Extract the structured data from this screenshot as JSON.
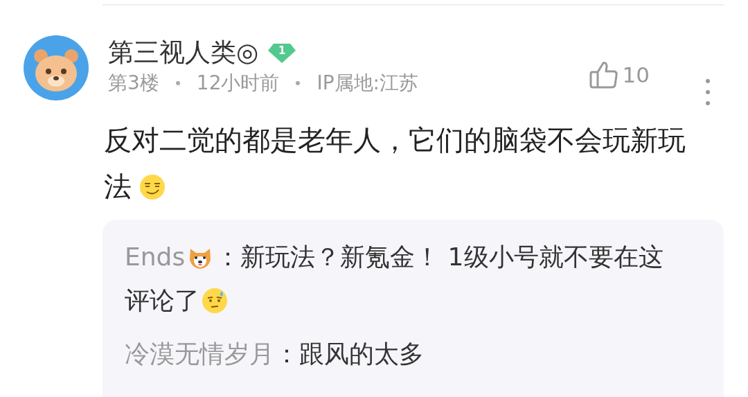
{
  "comment": {
    "author": "第三视人类◎",
    "level_badge": "1",
    "floor": "第3楼",
    "time": "12小时前",
    "ip": "IP属地:江苏",
    "likes": "10",
    "text_lines": [
      "反对二觉的都是老年人，它们的脑袋不会玩新玩",
      "法"
    ],
    "trailing_emoji": true
  },
  "replies": [
    {
      "user": "Ends",
      "user_emoji": true,
      "text_lines": [
        "：新玩法？新氪金！ 1级小号就不要在这",
        "评论了"
      ],
      "trailing_emoji": true
    },
    {
      "user": "冷漠无情岁月",
      "user_emoji": false,
      "text_lines": [
        "：跟风的太多"
      ],
      "trailing_emoji": false
    }
  ]
}
